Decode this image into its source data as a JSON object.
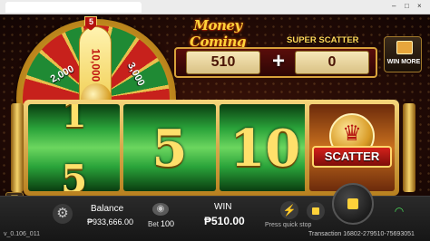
{
  "game": {
    "title": "Money Coming",
    "super_scatter_label": "SUPER SCATTER",
    "win_more_label": "WIN MORE"
  },
  "wheel": {
    "segment_left": "2,000",
    "segment_center": "10,000",
    "segment_right": "3,000",
    "pointer": "5"
  },
  "multiplier": {
    "left_value": "510",
    "operator": "+",
    "right_value": "0"
  },
  "reels": {
    "reel1_top": "1",
    "reel1_bottom": "5",
    "reel2": "5",
    "reel3": "10",
    "scatter_label": "SCATTER"
  },
  "bottom_bar": {
    "balance_label": "Balance",
    "balance_value": "₱933,666.00",
    "bet_label": "Bet",
    "bet_value": "100",
    "win_label": "WIN",
    "win_value": "₱510.00",
    "quick_stop_label": "Press quick stop",
    "version": "v_0.106_011",
    "transaction": "Transaction 16802-279510-75693051"
  },
  "colors": {
    "accent_gold": "#ffd23a",
    "reel_green": "#2aa33a",
    "scatter_red": "#d4221b",
    "wifi_green": "#4bdb5a"
  }
}
